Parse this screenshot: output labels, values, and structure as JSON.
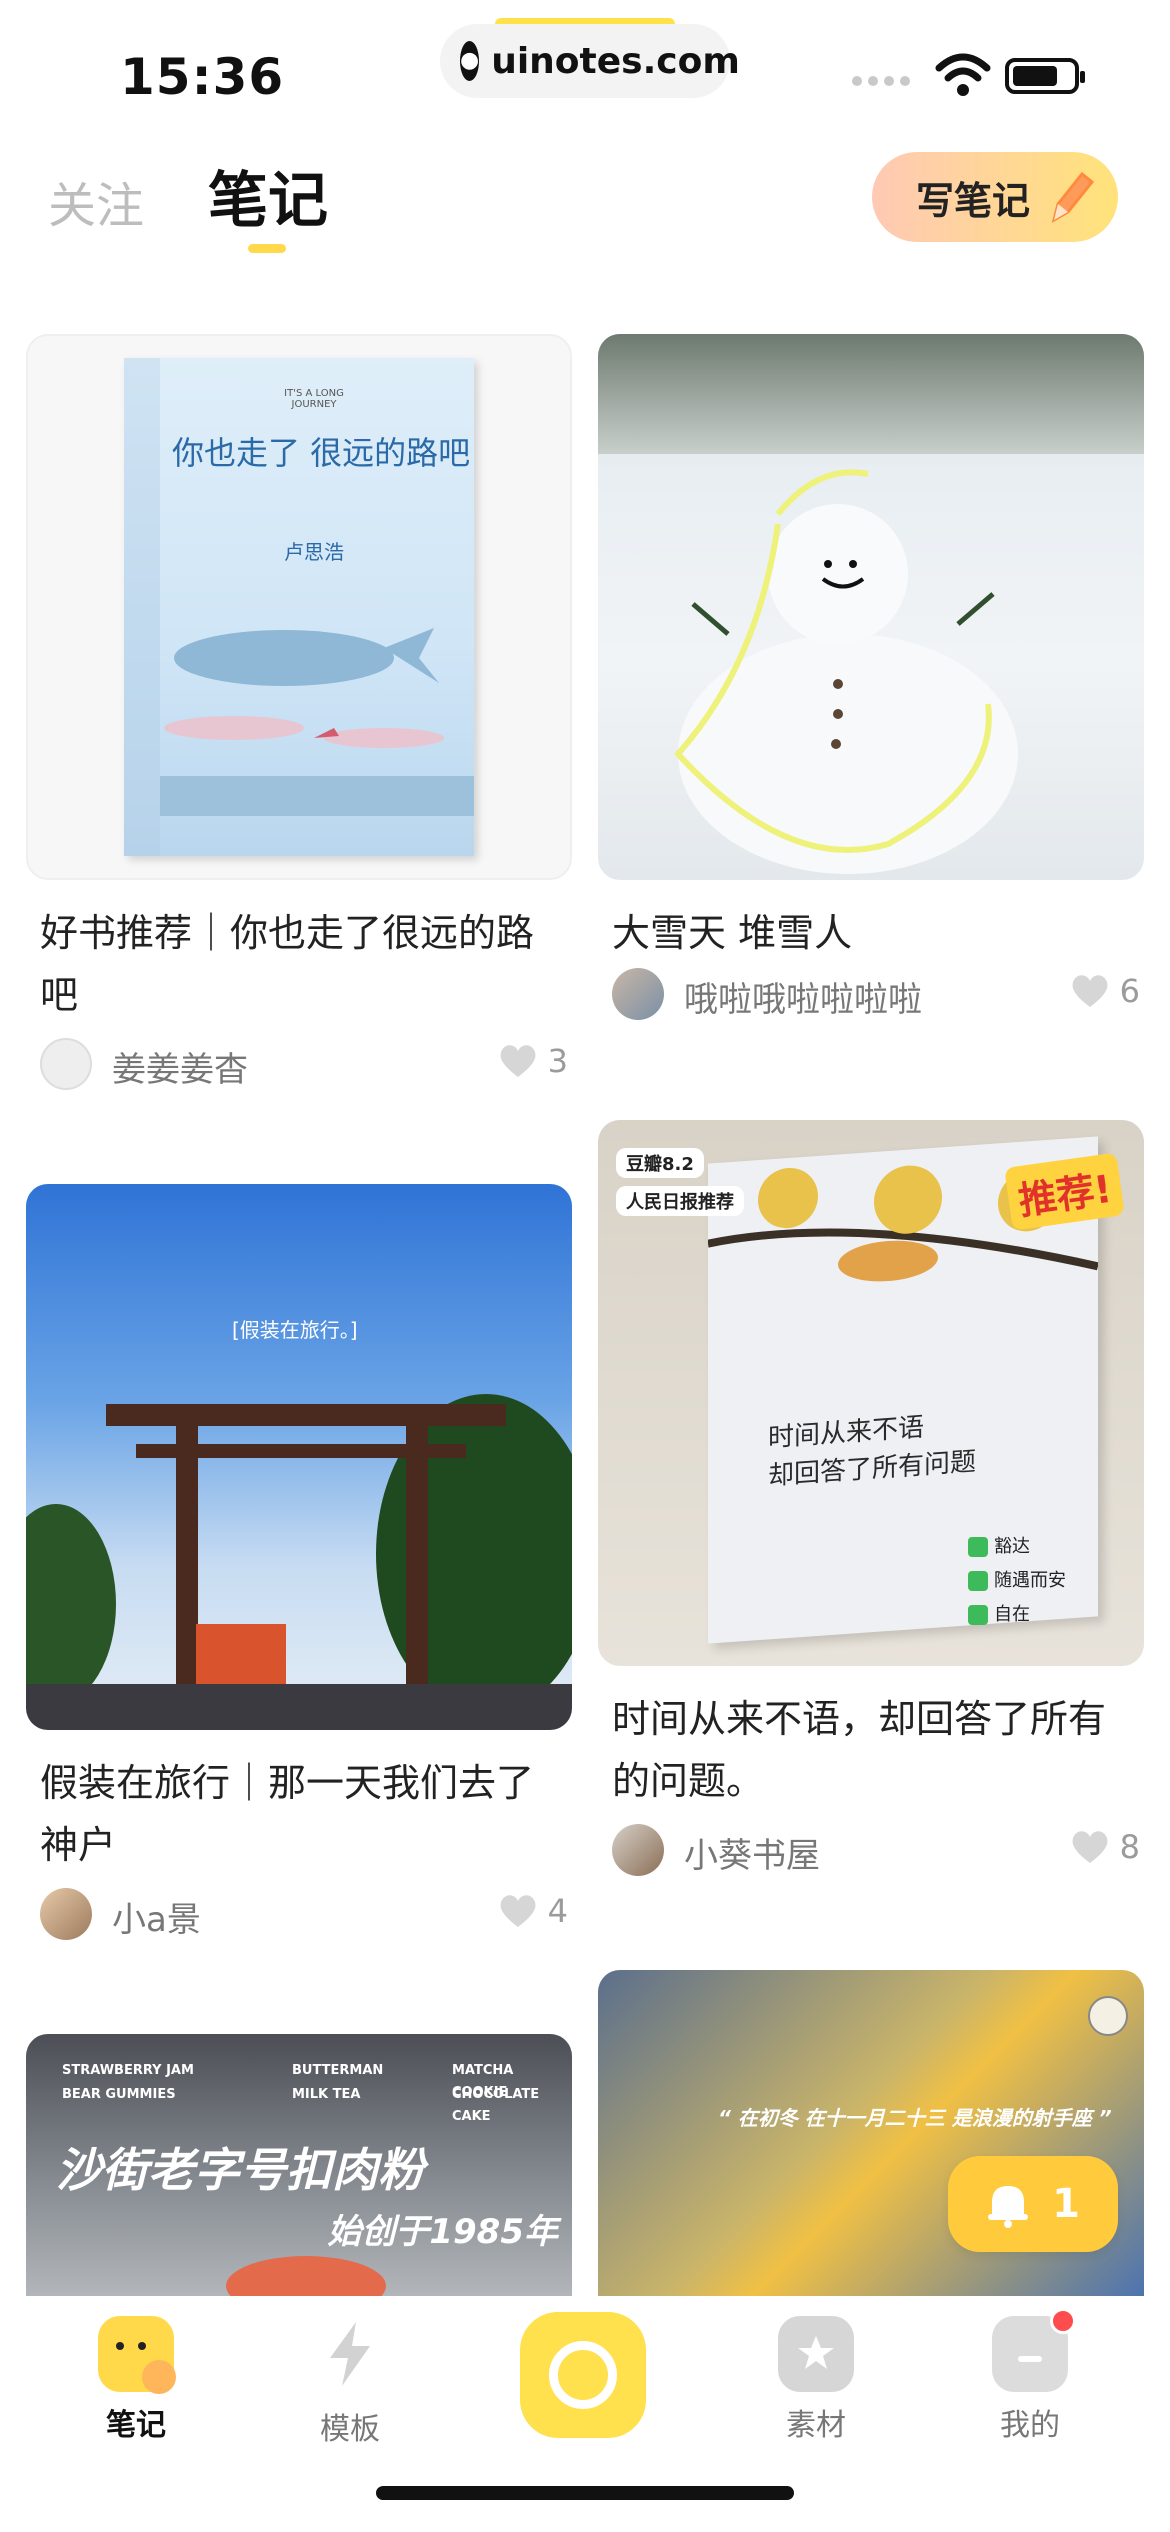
{
  "status_bar": {
    "time": "15:36",
    "url": "uinotes.com"
  },
  "header": {
    "tab_follow": "关注",
    "tab_notes": "笔记",
    "write_button": "写笔记"
  },
  "cards": [
    {
      "title": "好书推荐｜你也走了很远的路吧",
      "author": "姜姜姜杳",
      "likes": "3",
      "image_text": {
        "cover_title": "你也走了 很远的路吧",
        "cover_en": "IT'S A LONG JOURNEY",
        "cover_author": "卢思浩"
      }
    },
    {
      "title": "大雪天  堆雪人",
      "author": "哦啦哦啦啦啦啦",
      "likes": "6"
    },
    {
      "title": "假装在旅行｜那一天我们去了神户",
      "author": "小a景",
      "likes": "4",
      "image_text": {
        "caption": "[假装在旅行。]"
      }
    },
    {
      "title": "时间从来不语，却回答了所有的问题。",
      "author": "小葵书屋",
      "likes": "8",
      "image_text": {
        "badge1": "豆瓣8.2",
        "badge2": "人民日报推荐",
        "stamp": "推荐!",
        "book_title": "时间从来不语\n却回答了所有问题",
        "check1": "豁达",
        "check2": "随遇而安",
        "check3": "自在"
      }
    },
    {
      "image_text": {
        "small1": "STRAWBERRY JAM",
        "small2": "BUTTERMAN",
        "small3": "MATCHA COOKIE",
        "small4": "BEAR GUMMIES",
        "small5": "MILK TEA",
        "small6": "CHOCOLATE CAKE",
        "headline": "沙街老字号扣肉粉",
        "sub": "始创于1985年"
      }
    },
    {
      "image_text": {
        "quote": "“ 在初冬 在十一月二十三 是浪漫的射手座 ”"
      }
    }
  ],
  "notification": {
    "count": "1"
  },
  "bottom_nav": [
    {
      "label": "笔记"
    },
    {
      "label": "模板"
    },
    {
      "label": "素材"
    },
    {
      "label": "我的"
    }
  ],
  "colors": {
    "accent": "#ffd94a",
    "active_text": "#111111",
    "inactive_text": "#777777"
  }
}
